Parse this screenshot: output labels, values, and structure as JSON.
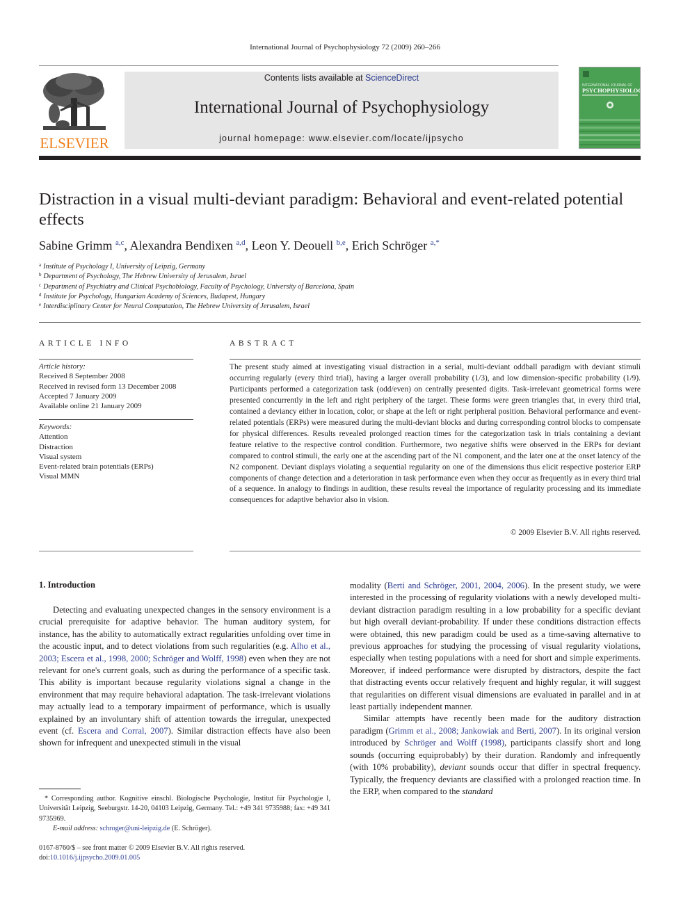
{
  "running_head": "International Journal of Psychophysiology 72 (2009) 260–266",
  "masthead": {
    "publisher": "ELSEVIER",
    "contents_prefix": "Contents lists available at ",
    "contents_link": "ScienceDirect",
    "journal_title": "International Journal of Psychophysiology",
    "homepage_prefix": "journal homepage: ",
    "homepage_url": "www.elsevier.com/locate/ijpsycho",
    "cover": {
      "line1": "INTERNATIONAL JOURNAL OF",
      "line2": "PSYCHOPHYSIOLOGY",
      "color": "#4aa053"
    }
  },
  "article": {
    "title": "Distraction in a visual multi-deviant paradigm: Behavioral and event-related potential effects",
    "authors": [
      {
        "name": "Sabine Grimm",
        "sup": "a,c",
        "sep": ", "
      },
      {
        "name": "Alexandra Bendixen",
        "sup": "a,d",
        "sep": ", "
      },
      {
        "name": "Leon Y. Deouell",
        "sup": "b,e",
        "sep": ", "
      },
      {
        "name": "Erich Schröger",
        "sup": "a,*",
        "sep": ""
      }
    ],
    "affiliations": [
      {
        "key": "a",
        "text": "Institute of Psychology I, University of Leipzig, Germany"
      },
      {
        "key": "b",
        "text": "Department of Psychology, The Hebrew University of Jerusalem, Israel"
      },
      {
        "key": "c",
        "text": "Department of Psychiatry and Clinical Psychobiology, Faculty of Psychology, University of Barcelona, Spain"
      },
      {
        "key": "d",
        "text": "Institute for Psychology, Hungarian Academy of Sciences, Budapest, Hungary"
      },
      {
        "key": "e",
        "text": "Interdisciplinary Center for Neural Computation, The Hebrew University of Jerusalem, Israel"
      }
    ]
  },
  "article_info": {
    "heading": "ARTICLE INFO",
    "history_label": "Article history:",
    "history": [
      "Received 8 September 2008",
      "Received in revised form 13 December 2008",
      "Accepted 7 January 2009",
      "Available online 21 January 2009"
    ],
    "keywords_label": "Keywords:",
    "keywords": [
      "Attention",
      "Distraction",
      "Visual system",
      "Event-related brain potentials (ERPs)",
      "Visual MMN"
    ]
  },
  "abstract": {
    "heading": "ABSTRACT",
    "text": "The present study aimed at investigating visual distraction in a serial, multi-deviant oddball paradigm with deviant stimuli occurring regularly (every third trial), having a larger overall probability (1/3), and low dimension-specific probability (1/9). Participants performed a categorization task (odd/even) on centrally presented digits. Task-irrelevant geometrical forms were presented concurrently in the left and right periphery of the target. These forms were green triangles that, in every third trial, contained a deviancy either in location, color, or shape at the left or right peripheral position. Behavioral performance and event-related potentials (ERPs) were measured during the multi-deviant blocks and during corresponding control blocks to compensate for physical differences. Results revealed prolonged reaction times for the categorization task in trials containing a deviant feature relative to the respective control condition. Furthermore, two negative shifts were observed in the ERPs for deviant compared to control stimuli, the early one at the ascending part of the N1 component, and the later one at the onset latency of the N2 component. Deviant displays violating a sequential regularity on one of the dimensions thus elicit respective posterior ERP components of change detection and a deterioration in task performance even when they occur as frequently as in every third trial of a sequence. In analogy to findings in audition, these results reveal the importance of regularity processing and its immediate consequences for adaptive behavior also in vision.",
    "copyright": "© 2009 Elsevier B.V. All rights reserved."
  },
  "introduction": {
    "heading": "1. Introduction",
    "left_col": {
      "p1_a": "Detecting and evaluating unexpected changes in the sensory environment is a crucial prerequisite for adaptive behavior. The human auditory system, for instance, has the ability to automatically extract regularities unfolding over time in the acoustic input, and to detect violations from such regularities (e.g. ",
      "p1_link1": "Alho et al., 2003; Escera et al., 1998, 2000; Schröger and Wolff, 1998",
      "p1_b": ") even when they are not relevant for one's current goals, such as during the performance of a specific task. This ability is important because regularity violations signal a change in the environment that may require behavioral adaptation. The task-irrelevant violations may actually lead to a temporary impairment of performance, which is usually explained by an involuntary shift of attention towards the irregular, unexpected event (cf. ",
      "p1_link2": "Escera and Corral, 2007",
      "p1_c": "). Similar distraction effects have also been shown for infrequent and unexpected stimuli in the visual"
    },
    "right_col": {
      "p1_a": "modality (",
      "p1_link1": "Berti and Schröger, 2001, 2004, 2006",
      "p1_b": "). In the present study, we were interested in the processing of regularity violations with a newly developed multi-deviant distraction paradigm resulting in a low probability for a specific deviant but high overall deviant-probability. If under these conditions distraction effects were obtained, this new paradigm could be used as a time-saving alternative to previous approaches for studying the processing of visual regularity violations, especially when testing populations with a need for short and simple experiments. Moreover, if indeed performance were disrupted by distractors, despite the fact that distracting events occur relatively frequent and highly regular, it will suggest that regularities on different visual dimensions are evaluated in parallel and in at least partially independent manner.",
      "p2_a": "Similar attempts have recently been made for the auditory distraction paradigm (",
      "p2_link1": "Grimm et al., 2008; Jankowiak and Berti, 2007",
      "p2_b": "). In its original version introduced by ",
      "p2_link2": "Schröger and Wolff (1998)",
      "p2_c": ", participants classify short and long sounds (occurring equiprobably) by their duration. Randomly and infrequently (with 10% probability), ",
      "p2_em1": "deviant",
      "p2_d": " sounds occur that differ in spectral frequency. Typically, the frequency deviants are classified with a prolonged reaction time. In the ERP, when compared to the ",
      "p2_em2": "standard"
    }
  },
  "footnote": {
    "corresponding": "* Corresponding author. Kognitive einschl. Biologische Psychologie, Institut für Psychologie I, Universität Leipzig, Seeburgstr. 14-20, 04103 Leipzig, Germany. Tel.: +49 341 9735988; fax: +49 341 9735969.",
    "email_label": "E-mail address:",
    "email": "schroger@uni-leipzig.de",
    "email_suffix": " (E. Schröger).",
    "front_matter": "0167-8760/$ – see front matter © 2009 Elsevier B.V. All rights reserved.",
    "doi_prefix": "doi:",
    "doi": "10.1016/j.ijpsycho.2009.01.005"
  },
  "colors": {
    "link": "#2b3c8f",
    "elsevier_orange": "#f07f1b",
    "masthead_gray": "#e6e6e6"
  }
}
